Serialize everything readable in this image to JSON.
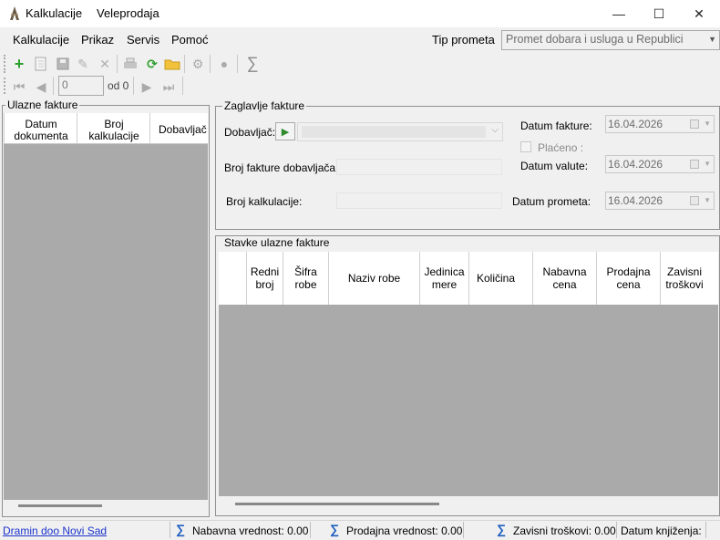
{
  "window": {
    "title": "Kalkulacije",
    "subtitle": "Veleprodaja",
    "minimize": "—",
    "maximize": "☐",
    "close": "✕"
  },
  "menu": {
    "items": [
      "Kalkulacije",
      "Prikaz",
      "Servis",
      "Pomoć"
    ],
    "tip_label": "Tip prometa",
    "tip_value": "Promet dobara i usluga u Republici"
  },
  "toolbar": {
    "icons": [
      "add-icon",
      "new-document-icon",
      "save-icon",
      "edit-icon",
      "delete-icon",
      "print-icon",
      "refresh-icon",
      "open-folder-icon",
      "settings-icon",
      "disabled-icon",
      "sum-icon"
    ]
  },
  "navigator": {
    "position": "0",
    "of_label": "od 0"
  },
  "left_panel": {
    "title": "Ulazne fakture",
    "columns": [
      "Datum dokumenta",
      "Broj kalkulacije",
      "Dobavljač"
    ]
  },
  "invoice_header": {
    "title": "Zaglavlje fakture",
    "supplier_label": "Dobavljač:",
    "supplier_invoice_label": "Broj fakture dobavljača:",
    "calc_number_label": "Broj kalkulacije:",
    "invoice_date_label": "Datum fakture:",
    "invoice_date": "16.04.2026",
    "paid_label": "Plaćeno :",
    "currency_date_label": "Datum valute:",
    "currency_date": "16.04.2026",
    "turnover_date_label": "Datum prometa:",
    "turnover_date": "16.04.2026"
  },
  "items_panel": {
    "title": "Stavke ulazne fakture",
    "columns": [
      "Redni broj",
      "Šifra robe",
      "Naziv robe",
      "Jedinica mere",
      "Količina",
      "Nabavna cena",
      "Prodajna cena",
      "Zavisni troškovi"
    ]
  },
  "status": {
    "company": "Dramin doo Novi Sad",
    "nabavna": "Nabavna vrednost: 0.00",
    "prodajna": "Prodajna vrednost: 0.00",
    "zavisni": "Zavisni troškovi: 0.00",
    "datum_knjizenja": "Datum knjiženja:",
    "sigma": "∑"
  }
}
